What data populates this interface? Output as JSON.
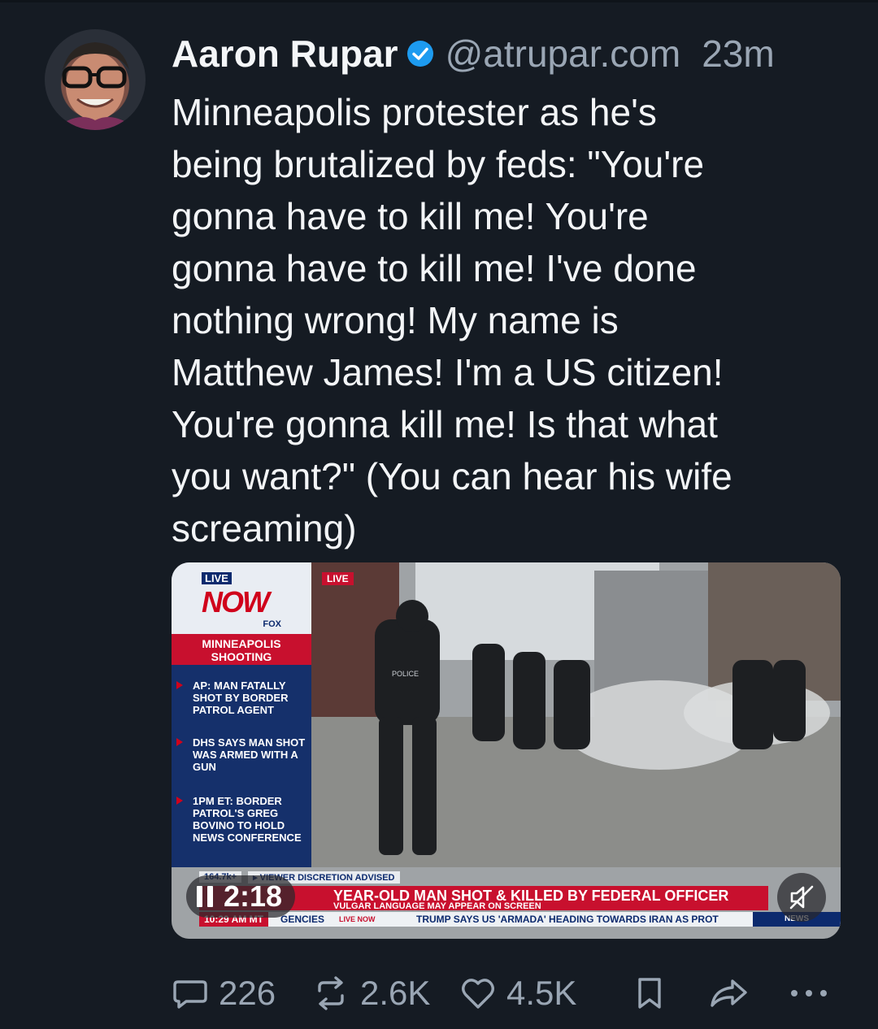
{
  "post": {
    "author_name": "Aaron Rupar",
    "handle": "@atrupar.com",
    "time_ago": "23m",
    "text": "Minneapolis protester as he's\nbeing brutalized by feds: \"You're\ngonna have to kill me! You're\ngonna have to kill me! I've done\nnothing wrong! My name is\nMatthew James! I'm a US citizen!\nYou're gonna kill me! Is that what\nyou want?\" (You can hear his wife\nscreaming)"
  },
  "video": {
    "duration": "2:18",
    "overlay": {
      "live_label": "LIVE",
      "now_label": "NOW",
      "fox_label": "FOX",
      "live_small": "LIVE",
      "topic": "MINNEAPOLIS SHOOTING",
      "bullets": [
        "AP: MAN FATALLY SHOT BY BORDER PATROL AGENT",
        "DHS SAYS MAN SHOT WAS ARMED WITH A GUN",
        "1PM ET: BORDER PATROL'S GREG BOVINO TO HOLD NEWS CONFERENCE"
      ],
      "views": "164.7k+",
      "discretion": "▸ VIEWER DISCRETION ADVISED",
      "headline": "YEAR-OLD MAN SHOT & KILLED BY FEDERAL OFFICER",
      "subline": "VULGAR LANGUAGE MAY APPEAR ON SCREEN",
      "clock": "10:29 AM MT",
      "ticker_left": "GENCIES",
      "ticker_now": "LIVE NOW",
      "ticker_main": "TRUMP SAYS US 'ARMADA' HEADING TOWARDS IRAN AS PROT",
      "news_tag": "NEWS"
    }
  },
  "actions": {
    "replies": "226",
    "reposts": "2.6K",
    "likes": "4.5K"
  },
  "icons": [
    "verified-badge-icon",
    "pause-icon",
    "mute-icon",
    "reply-icon",
    "repost-icon",
    "like-icon",
    "bookmark-icon",
    "share-icon",
    "more-icon"
  ],
  "colors": {
    "background": "#151b23",
    "muted_text": "#9aa6b4",
    "verified_blue": "#1d9bf0",
    "fox_red": "#c8102e",
    "fox_blue": "#15306b"
  }
}
